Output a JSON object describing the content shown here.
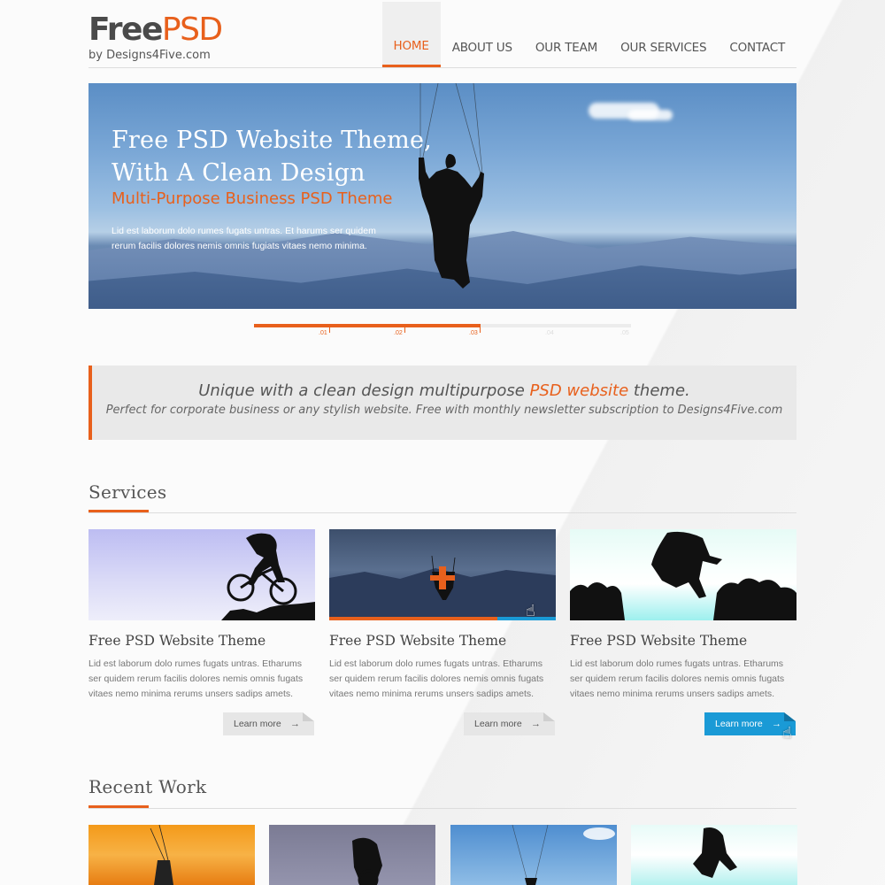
{
  "logo": {
    "main_part1": "Free",
    "main_part2": "PSD",
    "sub": "by Designs4Five.com"
  },
  "nav": {
    "items": [
      {
        "label": "HOME",
        "active": true
      },
      {
        "label": "ABOUT US",
        "active": false
      },
      {
        "label": "OUR TEAM",
        "active": false
      },
      {
        "label": "OUR SERVICES",
        "active": false
      },
      {
        "label": "CONTACT",
        "active": false
      }
    ]
  },
  "hero": {
    "title_line1": "Free PSD Website Theme,",
    "title_line2": "With A Clean Design",
    "subtitle": "Multi-Purpose Business PSD Theme",
    "text": "Lid est laborum dolo rumes fugats untras. Et harums ser quidem rerum facilis dolores nemis omnis fugiats vitaes nemo minima."
  },
  "slider": {
    "labels": [
      ".01",
      ".02",
      ".03",
      ".04",
      ".05"
    ],
    "active_count": 3
  },
  "quote": {
    "main_before": "Unique with a clean design multipurpose ",
    "main_highlight": "PSD website",
    "main_after": " theme.",
    "sub": "Perfect for corporate business or any stylish website.  Free with monthly newsletter subscription to Designs4Five.com"
  },
  "services": {
    "title": "Services",
    "cards": [
      {
        "title": "Free PSD Website Theme",
        "text": "Lid est laborum dolo rumes fugats untras. Etharums ser quidem rerum facilis dolores nemis omnis fugats vitaes nemo minima rerums unsers sadips amets.",
        "button": "Learn more",
        "arrow": "→"
      },
      {
        "title": "Free PSD Website Theme",
        "text": "Lid est laborum dolo rumes fugats untras. Etharums ser quidem rerum facilis dolores nemis omnis fugats vitaes nemo minima rerums unsers sadips amets.",
        "button": "Learn more",
        "arrow": "→"
      },
      {
        "title": "Free PSD Website Theme",
        "text": "Lid est laborum dolo rumes fugats untras. Etharums ser quidem rerum facilis dolores nemis omnis fugats vitaes nemo minima rerums unsers sadips amets.",
        "button": "Learn more",
        "arrow": "→"
      }
    ]
  },
  "recent_work": {
    "title": "Recent Work"
  },
  "colors": {
    "accent": "#e8601c",
    "button_blue": "#1a9ad6"
  }
}
